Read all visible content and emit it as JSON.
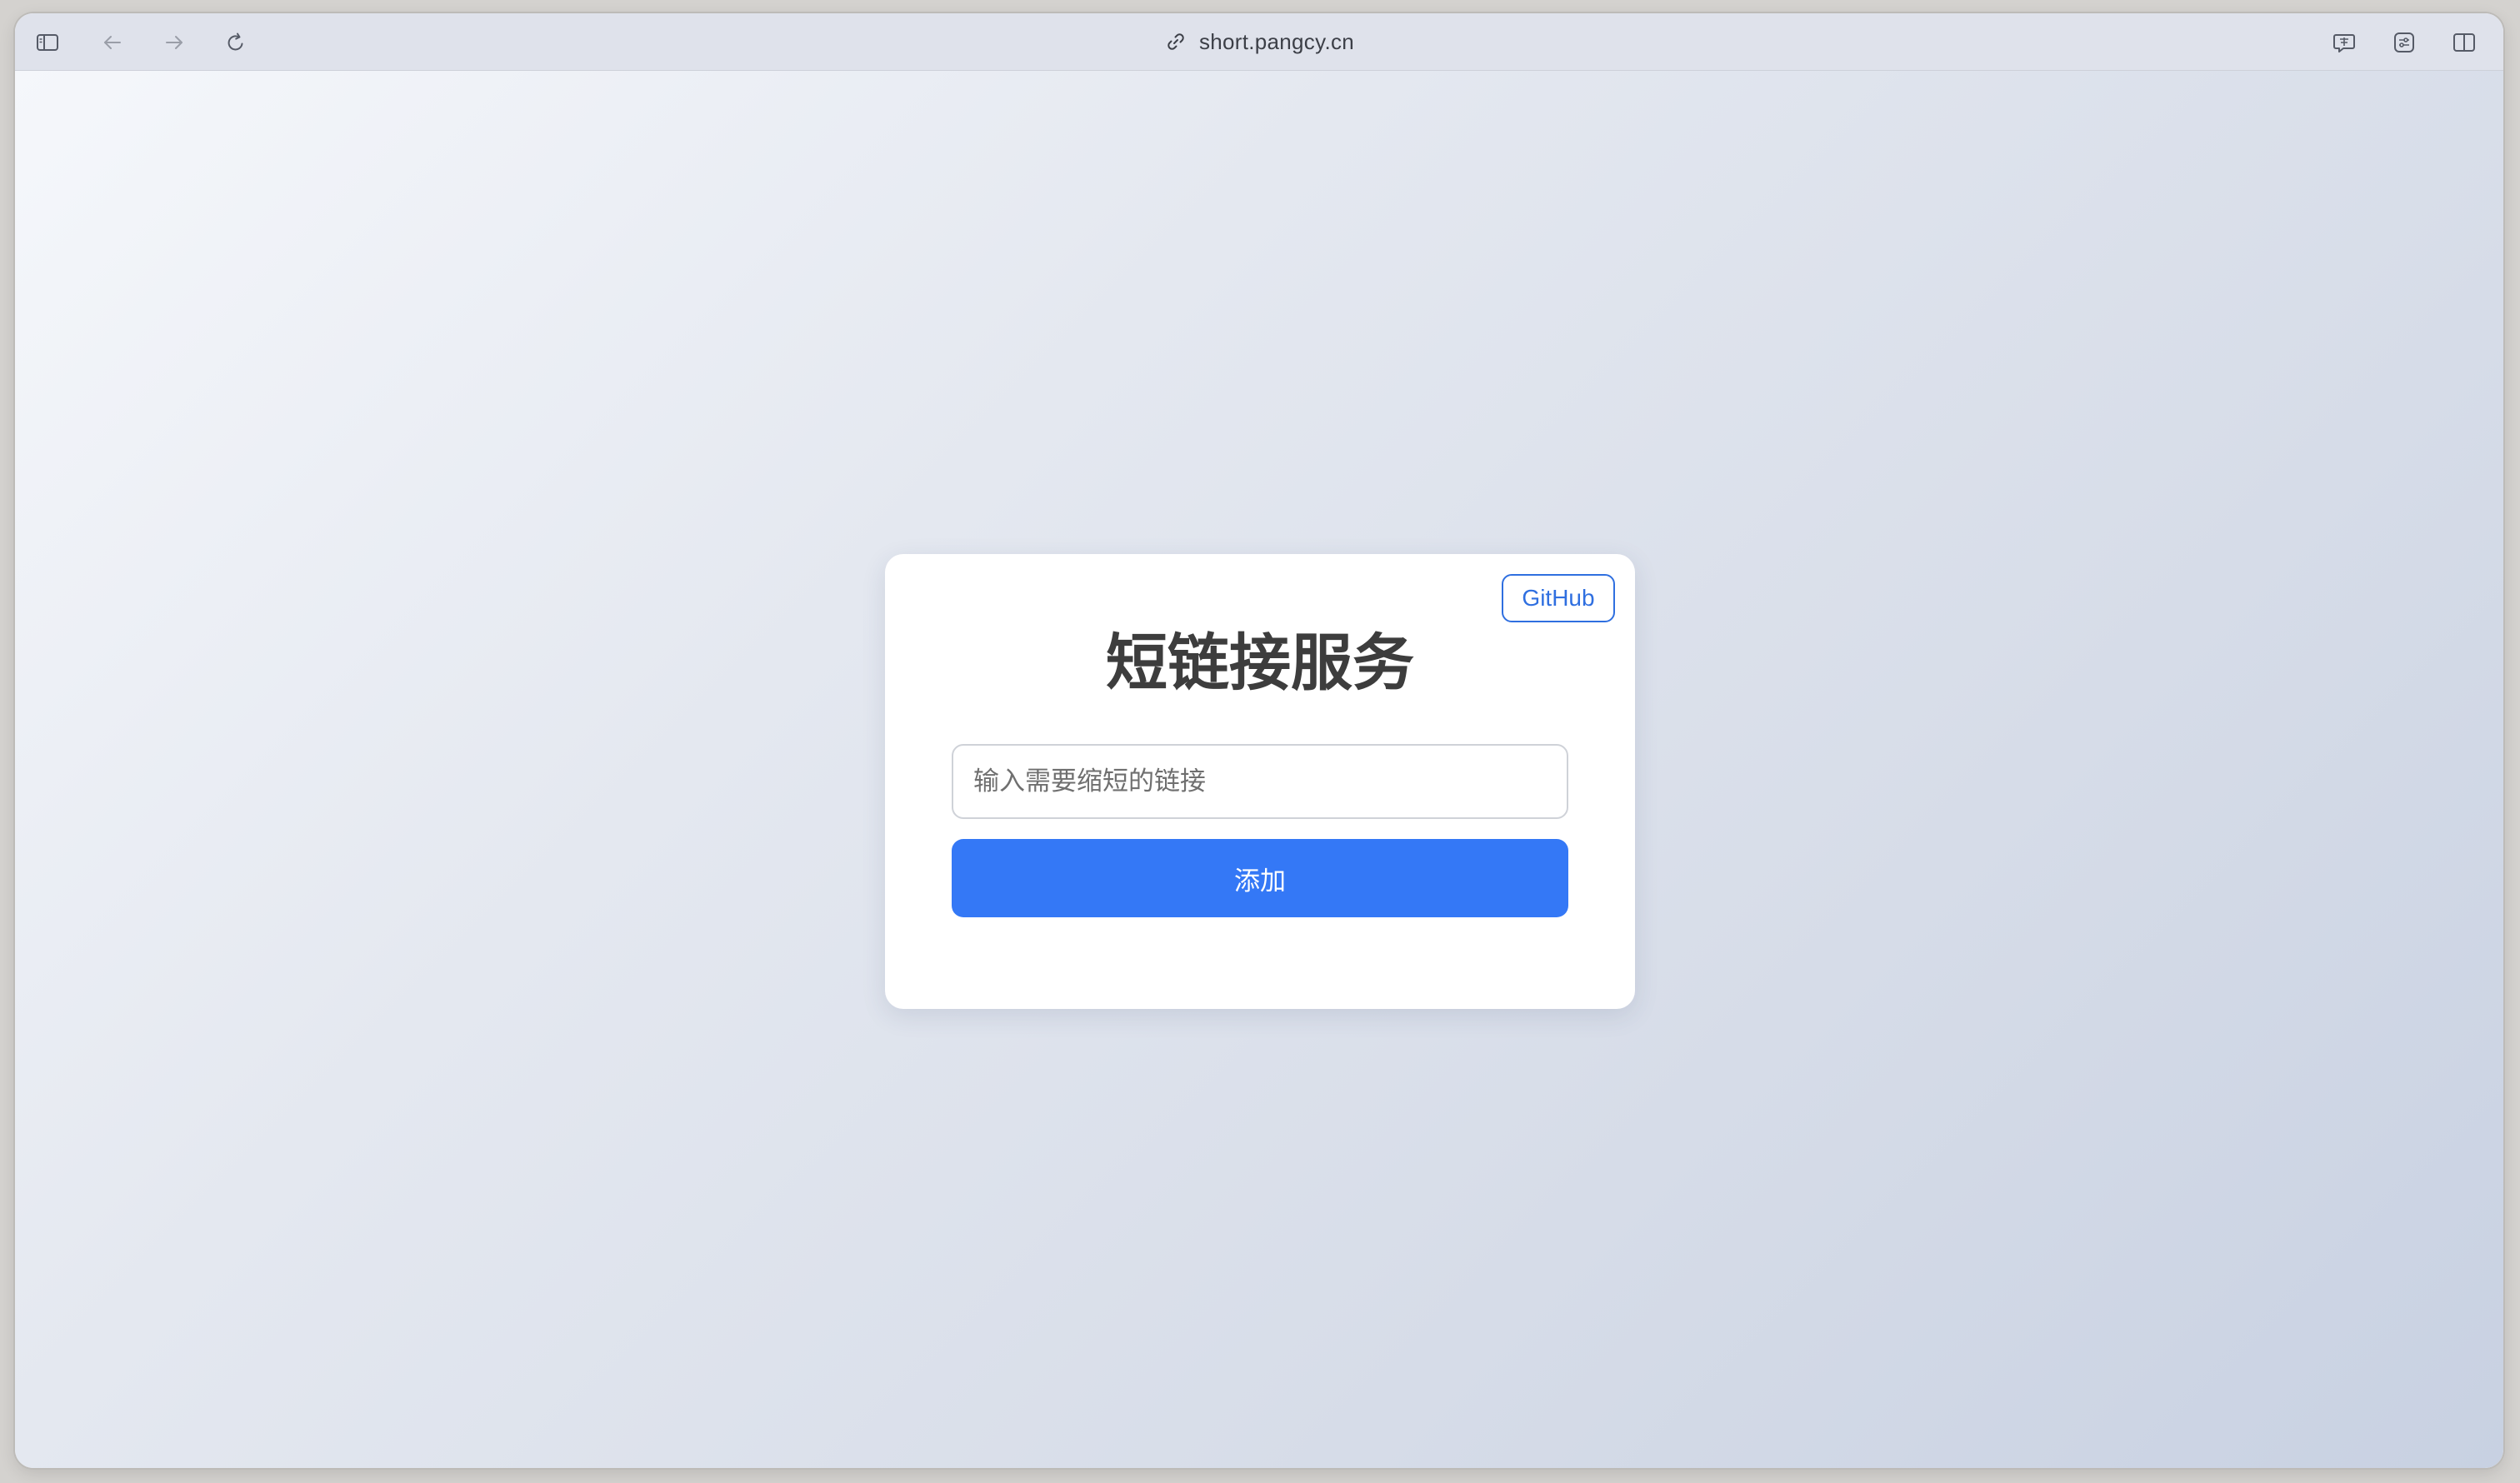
{
  "browser": {
    "url": "short.pangcy.cn",
    "icons": {
      "sidebar": "sidebar-toggle-icon",
      "back": "back-arrow-icon",
      "forward": "forward-arrow-icon",
      "reload": "reload-icon",
      "link": "link-icon",
      "translate": "translate-icon",
      "reader_settings": "page-settings-icon",
      "split_view": "split-view-icon"
    }
  },
  "page": {
    "github_label": "GitHub",
    "title": "短链接服务",
    "input_placeholder": "输入需要缩短的链接",
    "input_value": "",
    "add_button_label": "添加"
  },
  "colors": {
    "accent": "#3478f6",
    "github_border": "#2f6fe0",
    "title_text": "#3d3d3d",
    "toolbar_bg": "#dfe2eb"
  }
}
